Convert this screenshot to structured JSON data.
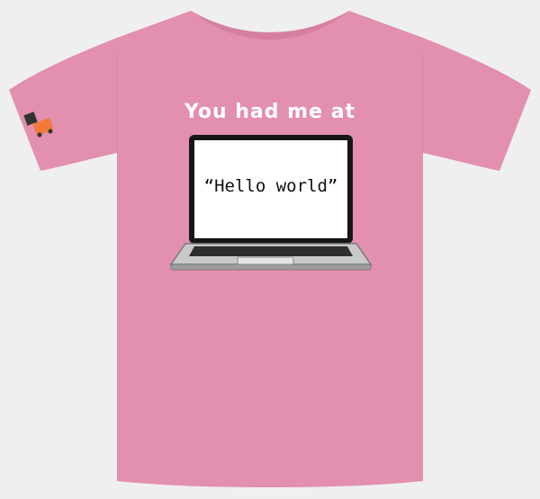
{
  "shirt": {
    "slogan": "You had me at",
    "screen_text": "“Hello world”",
    "colors": {
      "background": "#efefef",
      "shirt": "#e28fb0",
      "shirt_shadow": "#d67fa2",
      "laptop_frame": "#161616",
      "laptop_screen": "#ffffff",
      "laptop_base": "#c9c9c9",
      "keyboard": "#2e2e2e",
      "sleeve_logo": "#f07a3a"
    },
    "icons": {
      "laptop": "laptop-graphic",
      "sleeve_logo": "brand-logo-icon"
    }
  }
}
